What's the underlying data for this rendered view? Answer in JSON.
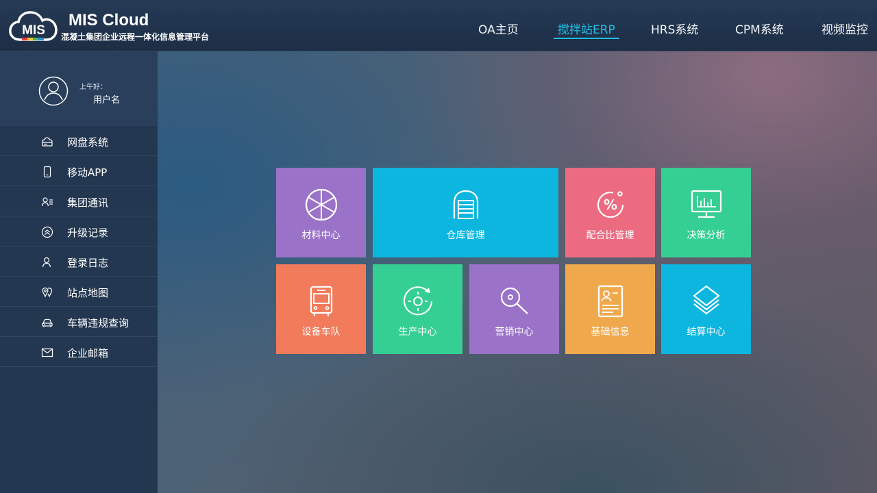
{
  "app": {
    "logo_text": "MIS",
    "title": "MIS Cloud",
    "subtitle": "混凝土集团企业远程一体化信息管理平台"
  },
  "nav": {
    "items": [
      {
        "label": "OA主页"
      },
      {
        "label": "搅拌站ERP",
        "active": true
      },
      {
        "label": "HRS系统"
      },
      {
        "label": "CPM系统"
      },
      {
        "label": "视频监控"
      }
    ]
  },
  "user": {
    "greeting": "上午好：",
    "name": "用户名"
  },
  "sidebar": {
    "items": [
      {
        "label": "网盘系统",
        "icon": "cloud-drive-icon"
      },
      {
        "label": "移动APP",
        "icon": "mobile-phone-icon"
      },
      {
        "label": "集团通讯",
        "icon": "contacts-icon"
      },
      {
        "label": "升级记录",
        "icon": "upgrade-icon"
      },
      {
        "label": "登录日志",
        "icon": "user-log-icon"
      },
      {
        "label": "站点地图",
        "icon": "map-pin-icon"
      },
      {
        "label": "车辆违规查询",
        "icon": "car-icon"
      },
      {
        "label": "企业邮箱",
        "icon": "mail-icon"
      }
    ]
  },
  "tiles": [
    {
      "label": "材料中心",
      "icon": "aperture-icon",
      "color": "#9a72c8"
    },
    {
      "label": "仓库管理",
      "icon": "warehouse-icon",
      "color": "#0db6de"
    },
    {
      "label": "配合比管理",
      "icon": "percent-icon",
      "color": "#ec6b80"
    },
    {
      "label": "决策分析",
      "icon": "monitor-chart-icon",
      "color": "#35cf93"
    },
    {
      "label": "设备车队",
      "icon": "bus-icon",
      "color": "#f27b5c"
    },
    {
      "label": "生产中心",
      "icon": "target-rotate-icon",
      "color": "#35cf93"
    },
    {
      "label": "营销中心",
      "icon": "search-tag-icon",
      "color": "#9a72c8"
    },
    {
      "label": "基础信息",
      "icon": "id-card-icon",
      "color": "#efa94c"
    },
    {
      "label": "结算中心",
      "icon": "layers-icon",
      "color": "#0db6de"
    }
  ]
}
